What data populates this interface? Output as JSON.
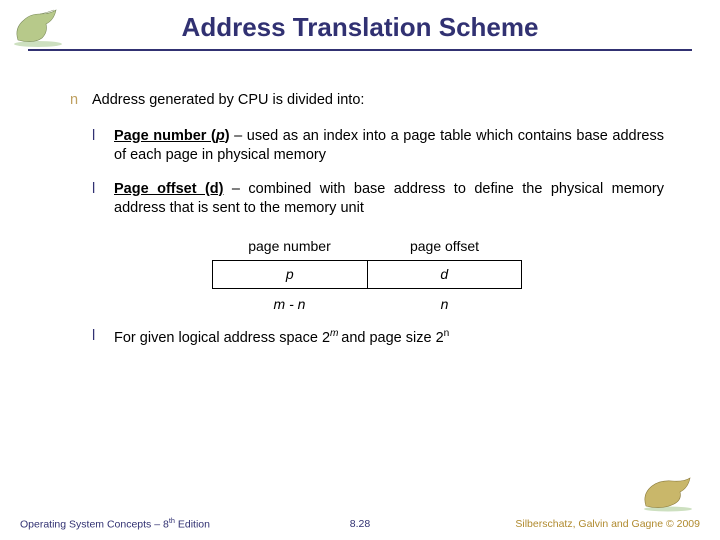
{
  "title": "Address Translation Scheme",
  "bullets": {
    "intro": "Address generated by CPU is divided into:",
    "page_number_bold": "Page number (",
    "page_number_var": "p",
    "page_number_close": ")",
    "page_number_desc": " – used as an index into a page table which contains base address of each page in physical memory",
    "page_offset_bold": "Page offset (d)",
    "page_offset_desc": " – combined with base address to define the physical memory address that is sent to the memory unit",
    "final_prefix": "For given logical address space 2",
    "final_exp1": "m ",
    "final_mid": "and page size 2",
    "final_exp2": "n"
  },
  "diagram": {
    "header_left": "page number",
    "header_right": "page offset",
    "box_left": "p",
    "box_right": "d",
    "bits_left": "m - n",
    "bits_right": "n"
  },
  "footer": {
    "left_prefix": "Operating System Concepts – 8",
    "left_sup": "th",
    "left_suffix": " Edition",
    "center": "8.28",
    "right": "Silberschatz, Galvin and Gagne © 2009"
  }
}
